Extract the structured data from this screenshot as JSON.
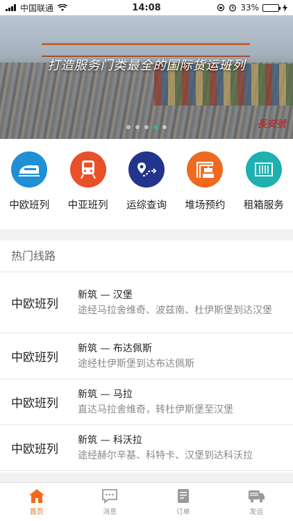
{
  "status_bar": {
    "carrier": "中国联通",
    "time": "14:08",
    "battery": "33%",
    "battery_level": 0.33
  },
  "banner": {
    "title": "打造服务门类最全的国际货运班列",
    "logo_text": "長安號",
    "slide_count": 5,
    "active_slide": 3
  },
  "services": [
    {
      "label": "中欧班列",
      "icon": "train-icon",
      "color": "#1f8fd6"
    },
    {
      "label": "中亚班列",
      "icon": "locomotive-icon",
      "color": "#e8502a"
    },
    {
      "label": "运综查询",
      "icon": "route-pin-icon",
      "color": "#22348c"
    },
    {
      "label": "堆场预约",
      "icon": "crane-icon",
      "color": "#ee6a1f"
    },
    {
      "label": "租箱服务",
      "icon": "container-icon",
      "color": "#1fb0b0"
    }
  ],
  "hot_routes": {
    "title": "热门线路",
    "items": [
      {
        "type": "中欧班列",
        "name": "新筑 — 汉堡",
        "via": "途经马拉舍维奇、波兹南、杜伊斯堡到达汉堡"
      },
      {
        "type": "中欧班列",
        "name": "新筑 — 布达佩斯",
        "via": "途经杜伊斯堡到达布达佩斯"
      },
      {
        "type": "中欧班列",
        "name": "新筑 — 马拉",
        "via": "直达马拉舍维奇，转杜伊斯堡至汉堡"
      },
      {
        "type": "中欧班列",
        "name": "新筑 — 科沃拉",
        "via": "途经赫尔辛基、科特卡、汉堡到达科沃拉"
      }
    ]
  },
  "tabbar": [
    {
      "label": "首页",
      "icon": "home-icon",
      "active": true
    },
    {
      "label": "消息",
      "icon": "message-icon",
      "active": false
    },
    {
      "label": "订单",
      "icon": "order-icon",
      "active": false
    },
    {
      "label": "发运",
      "icon": "shipping-icon",
      "active": false
    }
  ],
  "colors": {
    "accent": "#f46a1a",
    "slide_active": "#23b9a2"
  }
}
